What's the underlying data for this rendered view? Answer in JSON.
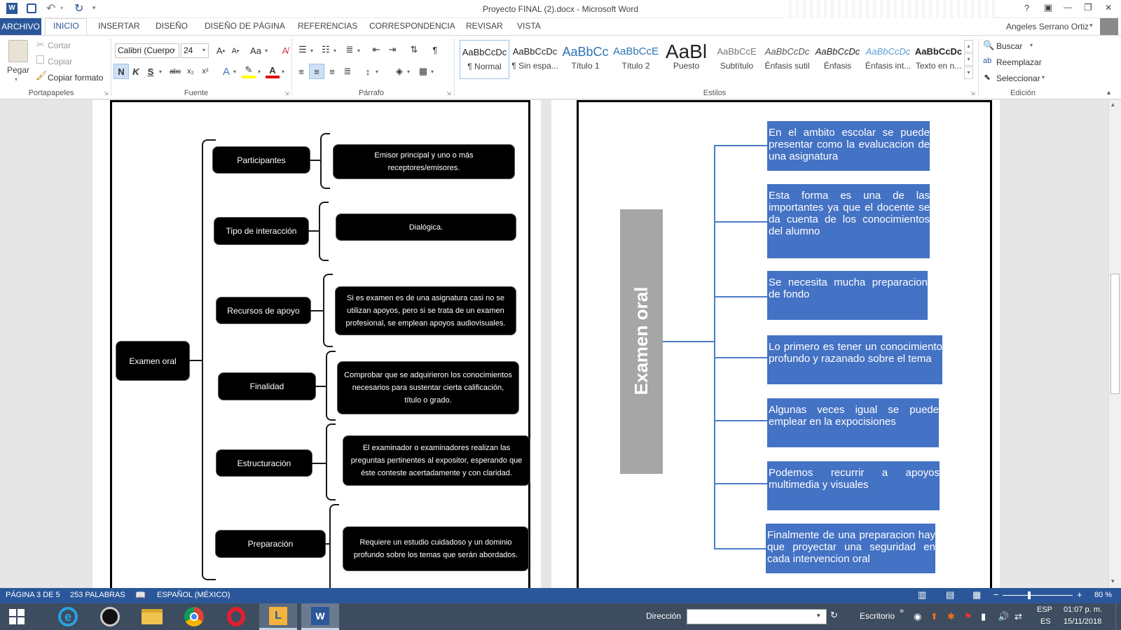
{
  "titlebar": {
    "title": "Proyecto FINAL (2).docx - Microsoft Word",
    "help": "?",
    "restore_ribbon": "▣",
    "minimize": "—",
    "maximize": "❐",
    "close": "✕"
  },
  "tabs": {
    "file": "ARCHIVO",
    "items": [
      "INICIO",
      "INSERTAR",
      "DISEÑO",
      "DISEÑO DE PÁGINA",
      "REFERENCIAS",
      "CORRESPONDENCIA",
      "REVISAR",
      "VISTA"
    ],
    "user": "Angeles Serrano Ortiz"
  },
  "clipboard": {
    "paste": "Pegar",
    "cut": "Cortar",
    "copy": "Copiar",
    "format_painter": "Copiar formato",
    "label": "Portapapeles"
  },
  "font": {
    "name": "Calibri (Cuerpo",
    "size": "24",
    "label": "Fuente",
    "bold": "N",
    "italic": "K",
    "underline": "S",
    "strike": "abc",
    "sub": "x₂",
    "sup": "x²",
    "change_case": "Aa"
  },
  "paragraph": {
    "label": "Párrafo"
  },
  "styles": {
    "label": "Estilos",
    "items": [
      {
        "preview": "AaBbCcDc",
        "name": "¶ Normal"
      },
      {
        "preview": "AaBbCcDc",
        "name": "¶ Sin espa..."
      },
      {
        "preview": "AaBbCc",
        "name": "Título 1"
      },
      {
        "preview": "AaBbCcE",
        "name": "Título 2"
      },
      {
        "preview": "AaBl",
        "name": "Puesto"
      },
      {
        "preview": "AaBbCcE",
        "name": "Subtítulo"
      },
      {
        "preview": "AaBbCcDc",
        "name": "Énfasis sutil"
      },
      {
        "preview": "AaBbCcDc",
        "name": "Énfasis"
      },
      {
        "preview": "AaBbCcDc",
        "name": "Énfasis int..."
      },
      {
        "preview": "AaBbCcDc",
        "name": "Texto en n..."
      }
    ]
  },
  "editing": {
    "find": "Buscar",
    "replace": "Reemplazar",
    "select": "Seleccionar",
    "label": "Edición"
  },
  "left_map": {
    "root": "Examen oral",
    "rows": [
      {
        "label": "Participantes",
        "text": "Emisor principal y uno o más receptores/emisores."
      },
      {
        "label": "Tipo de interacción",
        "text": "Dialógica."
      },
      {
        "label": "Recursos de apoyo",
        "text": "Si es examen es de una asignatura casi no se utilizan apoyos, pero si se trata de un examen profesional, se emplean apoyos audiovisuales."
      },
      {
        "label": "Finalidad",
        "text": "Comprobar que se adquirieron los conocimientos necesarios para sustentar cierta calificación, título o grado."
      },
      {
        "label": "Estructuración",
        "text": "El examinador o examinadores realizan las preguntas pertinentes al expositor, esperando que éste conteste acertadamente y con claridad."
      },
      {
        "label": "Preparación",
        "text": "Requiere un estudio cuidadoso y un dominio profundo sobre los temas que serán abordados."
      }
    ]
  },
  "right_map": {
    "root": "Examen oral",
    "items": [
      "En el ambito escolar se puede presentar como la evalucacion de una asignatura",
      "Esta forma es una de las importantes ya que el docente se da cuenta de los conocimientos del alumno",
      "Se necesita mucha preparacion de fondo",
      "Lo primero es tener un conocimiento profundo y razanado sobre el tema",
      "Algunas veces igual se puede emplear en la expocisiones",
      "Podemos recurrir a apoyos multimedia y visuales",
      "Finalmente de una preparacion hay que proyectar una seguridad en cada intervencion  oral"
    ],
    "colors": {
      "box": "#4472c4",
      "root": "#a6a6a6"
    }
  },
  "status": {
    "page": "PÁGINA 3 DE 5",
    "words": "253 PALABRAS",
    "language": "ESPAÑOL (MÉXICO)",
    "zoom": "80 %",
    "zoom_level": 0.8
  },
  "taskbar": {
    "address_label": "Dirección",
    "desktop": "Escritorio",
    "lang1": "ESP",
    "lang2": "ES",
    "time": "01:07 p. m.",
    "date": "15/11/2018"
  },
  "colors": {
    "accent": "#2b579a",
    "taskbar": "#3d4c5f"
  }
}
